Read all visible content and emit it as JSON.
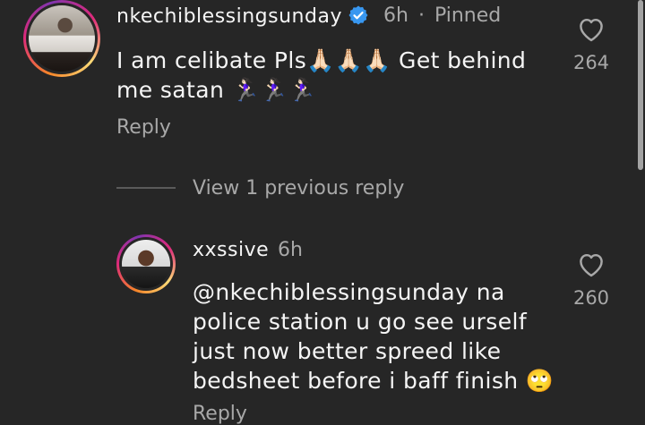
{
  "comment1": {
    "username": "nkechiblessingsunday",
    "time": "6h",
    "pinned": "Pinned",
    "separator": "·",
    "text_line1": "I am celibate Pls🙏🏻🙏🏻🙏🏻 Get behind",
    "text_line2": "me satan 🏃🏻‍♀️🏃🏻‍♀️🏃🏻‍♀️",
    "reply_label": "Reply",
    "likes": "264"
  },
  "thread": {
    "view_replies": "View 1 previous reply"
  },
  "comment2": {
    "username": "xxssive",
    "time": "6h",
    "text_line1": "@nkechiblessingsunday na",
    "text_line2": "police station u go see urself",
    "text_line3": "just now better spreed like",
    "text_line4": "bedsheet before i baff finish 🙄",
    "reply_label": "Reply",
    "likes": "260"
  },
  "colors": {
    "background": "#262626",
    "primary_text": "#f5f5f5",
    "secondary_text": "#a8a8a8",
    "verified_blue": "#3897f0"
  },
  "icons": [
    "verified-badge-icon",
    "heart-icon"
  ]
}
